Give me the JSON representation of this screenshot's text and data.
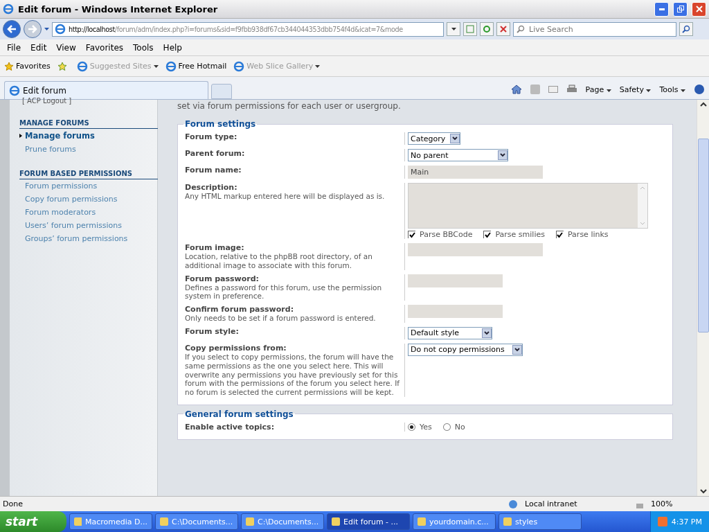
{
  "window": {
    "title": "Edit forum - Windows Internet Explorer"
  },
  "address_bar": {
    "url_host": "http://localhost",
    "url_path": "/forum/adm/index.php?i=forums&sid=f9fbb938df67cb344044353dbb754f4d&icat=7&mode"
  },
  "search": {
    "placeholder": "Live Search"
  },
  "menu": [
    "File",
    "Edit",
    "View",
    "Favorites",
    "Tools",
    "Help"
  ],
  "favorites_bar": {
    "label": "Favorites",
    "links": [
      {
        "label": "Suggested Sites",
        "disabled": true,
        "menu": true
      },
      {
        "label": "Free Hotmail",
        "disabled": false,
        "menu": false
      },
      {
        "label": "Web Slice Gallery",
        "disabled": true,
        "menu": true
      }
    ]
  },
  "tabs": [
    {
      "label": "Edit forum",
      "selected": true
    }
  ],
  "command_bar": [
    "Page",
    "Safety",
    "Tools"
  ],
  "sidebar": {
    "logout": "[ ACP Logout ]",
    "sections": [
      {
        "title": "MANAGE FORUMS",
        "items": [
          {
            "label": "Manage forums",
            "selected": true
          },
          {
            "label": "Prune forums",
            "selected": false
          }
        ]
      },
      {
        "title": "FORUM BASED PERMISSIONS",
        "items": [
          {
            "label": "Forum permissions",
            "selected": false
          },
          {
            "label": "Copy forum permissions",
            "selected": false
          },
          {
            "label": "Forum moderators",
            "selected": false
          },
          {
            "label": "Users’ forum permissions",
            "selected": false
          },
          {
            "label": "Groups’ forum permissions",
            "selected": false
          }
        ]
      }
    ]
  },
  "intro": "set via forum permissions for each user or usergroup.",
  "fieldsets": [
    {
      "legend": "Forum settings",
      "rows": [
        {
          "kind": "select",
          "label": "Forum type:",
          "value": "Category"
        },
        {
          "kind": "select",
          "label": "Parent forum:",
          "value": "No parent"
        },
        {
          "kind": "text",
          "label": "Forum name:",
          "value": "Main"
        },
        {
          "kind": "textarea",
          "label": "Description:",
          "explain": "Any HTML markup entered here will be displayed as is.",
          "checks": [
            {
              "label": "Parse BBCode",
              "checked": true
            },
            {
              "label": "Parse smilies",
              "checked": true
            },
            {
              "label": "Parse links",
              "checked": true
            }
          ]
        },
        {
          "kind": "text",
          "label": "Forum image:",
          "explain": "Location, relative to the phpBB root directory, of an additional image to associate with this forum."
        },
        {
          "kind": "text",
          "label": "Forum password:",
          "explain": "Defines a password for this forum, use the permission system in preference."
        },
        {
          "kind": "text",
          "label": "Confirm forum password:",
          "explain": "Only needs to be set if a forum password is entered."
        },
        {
          "kind": "select",
          "label": "Forum style:",
          "value": "Default style"
        },
        {
          "kind": "select",
          "label": "Copy permissions from:",
          "explain": "If you select to copy permissions, the forum will have the same permissions as the one you select here. This will overwrite any permissions you have previously set for this forum with the permissions of the forum you select here. If no forum is selected the current permissions will be kept.",
          "value": "Do not copy permissions"
        }
      ]
    },
    {
      "legend": "General forum settings",
      "rows": [
        {
          "kind": "radio",
          "label": "Enable active topics:",
          "options": [
            {
              "label": "Yes",
              "selected": true
            },
            {
              "label": "No",
              "selected": false
            }
          ]
        }
      ]
    }
  ],
  "status_bar": {
    "text": "Done",
    "zone": "Local intranet",
    "zoom": "100%"
  },
  "taskbar": {
    "start": "start",
    "items": [
      {
        "label": "Macromedia D...",
        "selected": false
      },
      {
        "label": "C:\\Documents...",
        "selected": false
      },
      {
        "label": "C:\\Documents...",
        "selected": false
      },
      {
        "label": "Edit forum - ...",
        "selected": true
      },
      {
        "label": "yourdomain.c...",
        "selected": false
      },
      {
        "label": "styles",
        "selected": false
      }
    ],
    "clock": "4:37 PM"
  }
}
